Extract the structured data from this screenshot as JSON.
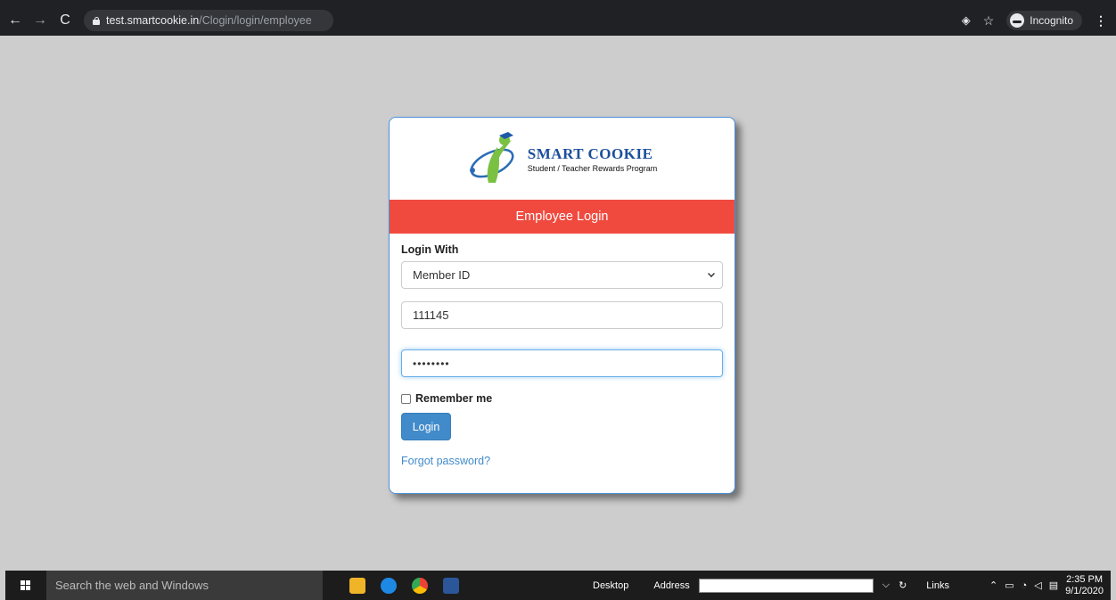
{
  "browser": {
    "url_host": "test.smartcookie.in",
    "url_path": "/Clogin/login/employee",
    "incognito_label": "Incognito"
  },
  "logo": {
    "title": "SMART COOKIE",
    "subtitle": "Student / Teacher Rewards Program"
  },
  "banner": "Employee Login",
  "form": {
    "login_with_label": "Login With",
    "login_with_value": "Member ID",
    "member_id_value": "111145",
    "password_masked": "••••••••",
    "remember_label": "Remember me",
    "login_button": "Login",
    "forgot_link": "Forgot password?"
  },
  "taskbar": {
    "search_placeholder": "Search the web and Windows",
    "desktop_label": "Desktop",
    "address_label": "Address",
    "links_label": "Links",
    "time": "2:35 PM",
    "date": "9/1/2020"
  },
  "colors": {
    "banner": "#f04a3f",
    "button": "#428bca",
    "brand": "#1b4f9c"
  }
}
